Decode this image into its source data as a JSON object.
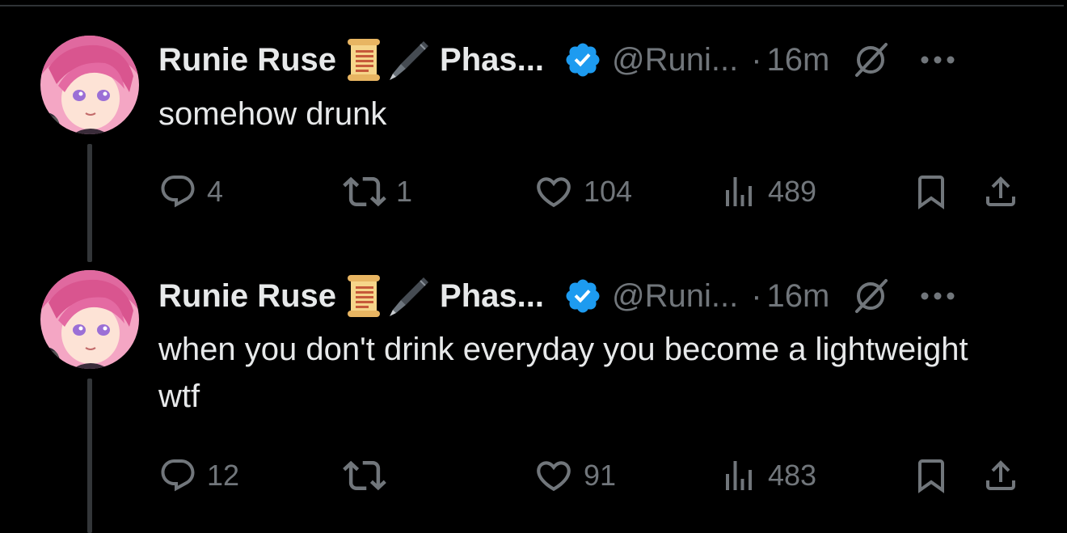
{
  "tweets": [
    {
      "author": {
        "name": "Runie Ruse",
        "name_suffix": "Phas...",
        "handle": "@Runi...",
        "verified": true,
        "emojis": [
          "scroll-emoji",
          "fountain-pen-emoji"
        ]
      },
      "dot": "·",
      "time": "16m",
      "text": "somehow drunk",
      "stats": {
        "replies": "4",
        "reposts": "1",
        "likes": "104",
        "views": "489"
      }
    },
    {
      "author": {
        "name": "Runie Ruse",
        "name_suffix": "Phas...",
        "handle": "@Runi...",
        "verified": true,
        "emojis": [
          "scroll-emoji",
          "fountain-pen-emoji"
        ]
      },
      "dot": "·",
      "time": "16m",
      "text": "when you don't drink everyday you become a lightweight wtf",
      "stats": {
        "replies": "12",
        "reposts": "",
        "likes": "91",
        "views": "483"
      }
    }
  ],
  "colors": {
    "background": "#000000",
    "primary_text": "#e7e9ea",
    "secondary_text": "#71767b",
    "verified_blue": "#1d9bf0",
    "thread_line": "#333639"
  },
  "icons": {
    "reply": "reply-icon",
    "repost": "repost-icon",
    "like": "heart-icon",
    "views": "views-icon",
    "bookmark": "bookmark-icon",
    "share": "share-icon",
    "muted": "muted-icon",
    "more": "more-icon",
    "verified": "verified-badge-icon"
  }
}
